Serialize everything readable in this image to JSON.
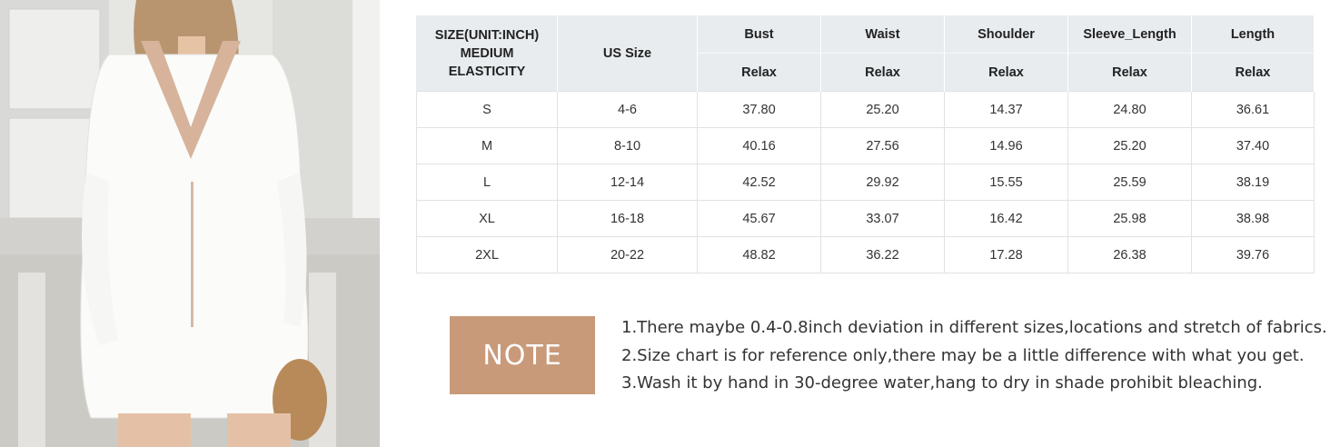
{
  "table": {
    "size_header": [
      "SIZE(UNIT:INCH)",
      "MEDIUM",
      "ELASTICITY"
    ],
    "us_size_header": "US Size",
    "measure_headers": [
      "Bust",
      "Waist",
      "Shoulder",
      "Sleeve_Length",
      "Length"
    ],
    "sub_headers": [
      "Relax",
      "Relax",
      "Relax",
      "Relax",
      "Relax"
    ],
    "rows": [
      {
        "size": "S",
        "us": "4-6",
        "bust": "37.80",
        "waist": "25.20",
        "shoulder": "14.37",
        "sleeve": "24.80",
        "length": "36.61"
      },
      {
        "size": "M",
        "us": "8-10",
        "bust": "40.16",
        "waist": "27.56",
        "shoulder": "14.96",
        "sleeve": "25.20",
        "length": "37.40"
      },
      {
        "size": "L",
        "us": "12-14",
        "bust": "42.52",
        "waist": "29.92",
        "shoulder": "15.55",
        "sleeve": "25.59",
        "length": "38.19"
      },
      {
        "size": "XL",
        "us": "16-18",
        "bust": "45.67",
        "waist": "33.07",
        "shoulder": "16.42",
        "sleeve": "25.98",
        "length": "38.98"
      },
      {
        "size": "2XL",
        "us": "20-22",
        "bust": "48.82",
        "waist": "36.22",
        "shoulder": "17.28",
        "sleeve": "26.38",
        "length": "39.76"
      }
    ]
  },
  "note": {
    "label": "NOTE",
    "lines": [
      "1.There maybe 0.4-0.8inch deviation in different sizes,locations and stretch of fabrics.",
      "2.Size chart is for reference only,there may be a little difference with what you get.",
      "3.Wash it by hand in 30-degree water,hang to dry in shade prohibit bleaching."
    ]
  },
  "colors": {
    "note_badge": "#c99a7a",
    "header_bg": "#e8ecef",
    "border": "#dfe2e5"
  }
}
